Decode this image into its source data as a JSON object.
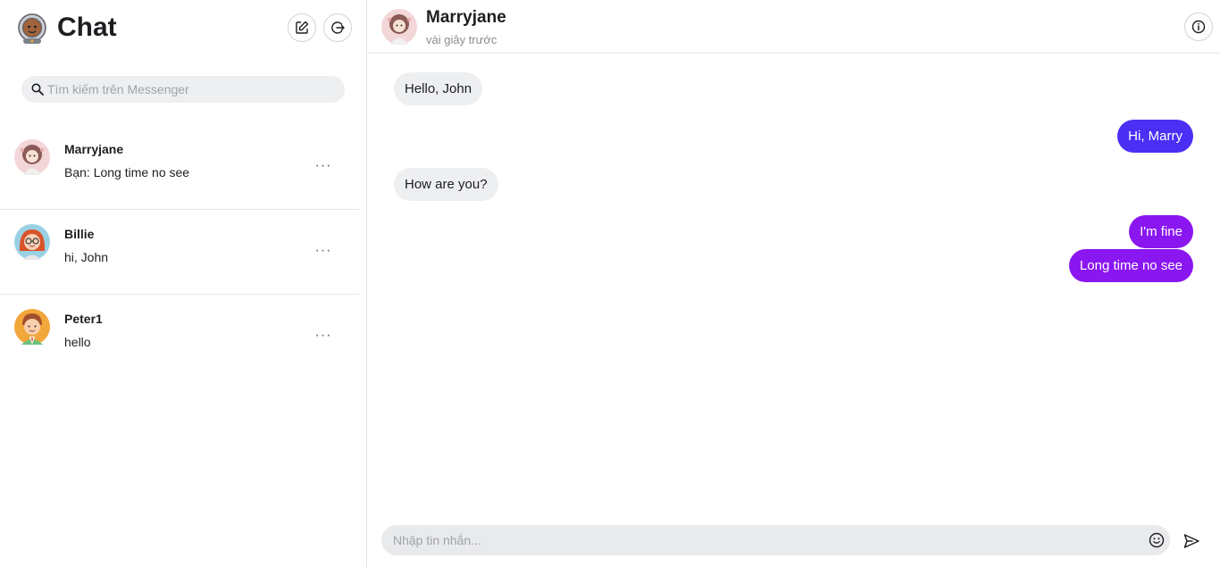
{
  "sidebar": {
    "title": "Chat",
    "logo_icon": "astronaut-logo-icon",
    "compose_icon": "edit-icon",
    "logout_icon": "logout-icon",
    "search": {
      "placeholder": "Tìm kiếm trên Messenger",
      "value": ""
    },
    "conversations": [
      {
        "name": "Marryjane",
        "preview": "Bạn: Long time no see",
        "more": "···",
        "avatar": "marryjane-avatar"
      },
      {
        "name": "Billie",
        "preview": "hi, John",
        "more": "···",
        "avatar": "billie-avatar"
      },
      {
        "name": "Peter1",
        "preview": "hello",
        "more": "···",
        "avatar": "peter-avatar"
      }
    ]
  },
  "chat": {
    "contact_name": "Marryjane",
    "status": "vài giây trước",
    "info_icon": "info-icon",
    "messages": [
      {
        "text": "Hello, John",
        "direction": "incoming"
      },
      {
        "text": "Hi, Marry",
        "direction": "outgoing",
        "color": "#4b2ff5"
      },
      {
        "text": "How are you?",
        "direction": "incoming"
      },
      {
        "text": "I'm fine",
        "direction": "outgoing",
        "color": "#8a16f0"
      },
      {
        "text": "Long time no see",
        "direction": "outgoing",
        "color": "#8a16f0"
      }
    ],
    "composer": {
      "placeholder": "Nhập tin nhắn...",
      "value": "",
      "emoji_icon": "smiley-icon",
      "send_icon": "send-icon"
    }
  },
  "colors": {
    "outgoing_blue": "#4b2ff5",
    "outgoing_purple": "#8a16f0",
    "incoming_bubble": "#eeeff1",
    "divider": "#e4e6eb"
  }
}
